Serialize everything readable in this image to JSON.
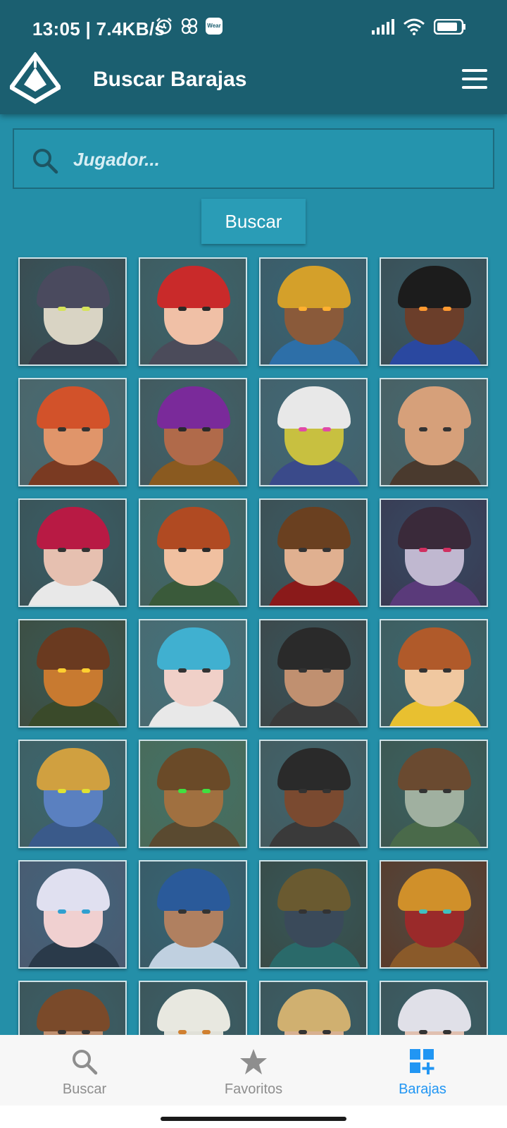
{
  "status_bar": {
    "time_speed": "13:05 | 7.4KB/s",
    "wear_badge": "Wear",
    "icons": [
      "alarm-icon",
      "pinwheel-icon",
      "wear-icon",
      "signal-icon",
      "wifi-icon",
      "battery-icon"
    ]
  },
  "app_bar": {
    "title": "Buscar Barajas",
    "logo_icon": "paladins-logo-icon",
    "menu_icon": "hamburger-menu-icon"
  },
  "search": {
    "placeholder": "Jugador...",
    "value": "",
    "button_label": "Buscar"
  },
  "colors": {
    "background": "#248fa8",
    "app_bar": "#1b5f70",
    "accent": "#2196f3",
    "nav_inactive": "#8e8e8e"
  },
  "champions": [
    {
      "portrait": "dark-horned-masked-champion-portrait"
    },
    {
      "portrait": "red-haired-woman-champion-portrait"
    },
    {
      "portrait": "hooded-old-sage-champion-portrait"
    },
    {
      "portrait": "horned-dark-skinned-champion-portrait"
    },
    {
      "portrait": "ginger-bearded-dwarf-champion-portrait"
    },
    {
      "portrait": "crowned-purple-haired-champion-portrait"
    },
    {
      "portrait": "golden-robot-champion-portrait"
    },
    {
      "portrait": "bald-monk-champion-portrait"
    },
    {
      "portrait": "crimson-haired-champion-portrait"
    },
    {
      "portrait": "braided-auburn-woman-champion-portrait"
    },
    {
      "portrait": "brown-haired-knight-champion-portrait"
    },
    {
      "portrait": "skeleton-pirate-champion-portrait"
    },
    {
      "portrait": "dragon-champion-portrait"
    },
    {
      "portrait": "blue-haired-girl-champion-portrait"
    },
    {
      "portrait": "rose-helmet-champion-portrait"
    },
    {
      "portrait": "auburn-woman-champion-portrait"
    },
    {
      "portrait": "blue-orc-champion-portrait"
    },
    {
      "portrait": "tree-ent-champion-portrait"
    },
    {
      "portrait": "medusa-champion-portrait"
    },
    {
      "portrait": "green-dryad-champion-portrait"
    },
    {
      "portrait": "silver-haired-elf-champion-portrait"
    },
    {
      "portrait": "blue-masked-champion-portrait"
    },
    {
      "portrait": "straw-hat-champion-portrait"
    },
    {
      "portrait": "crimson-helmet-champion-portrait"
    },
    {
      "portrait": "brown-haired-champion-portrait"
    },
    {
      "portrait": "goggled-white-haired-champion-portrait"
    },
    {
      "portrait": "blonde-champion-portrait"
    },
    {
      "portrait": "white-haired-jester-champion-portrait"
    }
  ],
  "bottom_nav": [
    {
      "label": "Buscar",
      "icon": "search-icon",
      "active": false
    },
    {
      "label": "Favoritos",
      "icon": "star-icon",
      "active": false
    },
    {
      "label": "Barajas",
      "icon": "add-deck-icon",
      "active": true
    }
  ]
}
